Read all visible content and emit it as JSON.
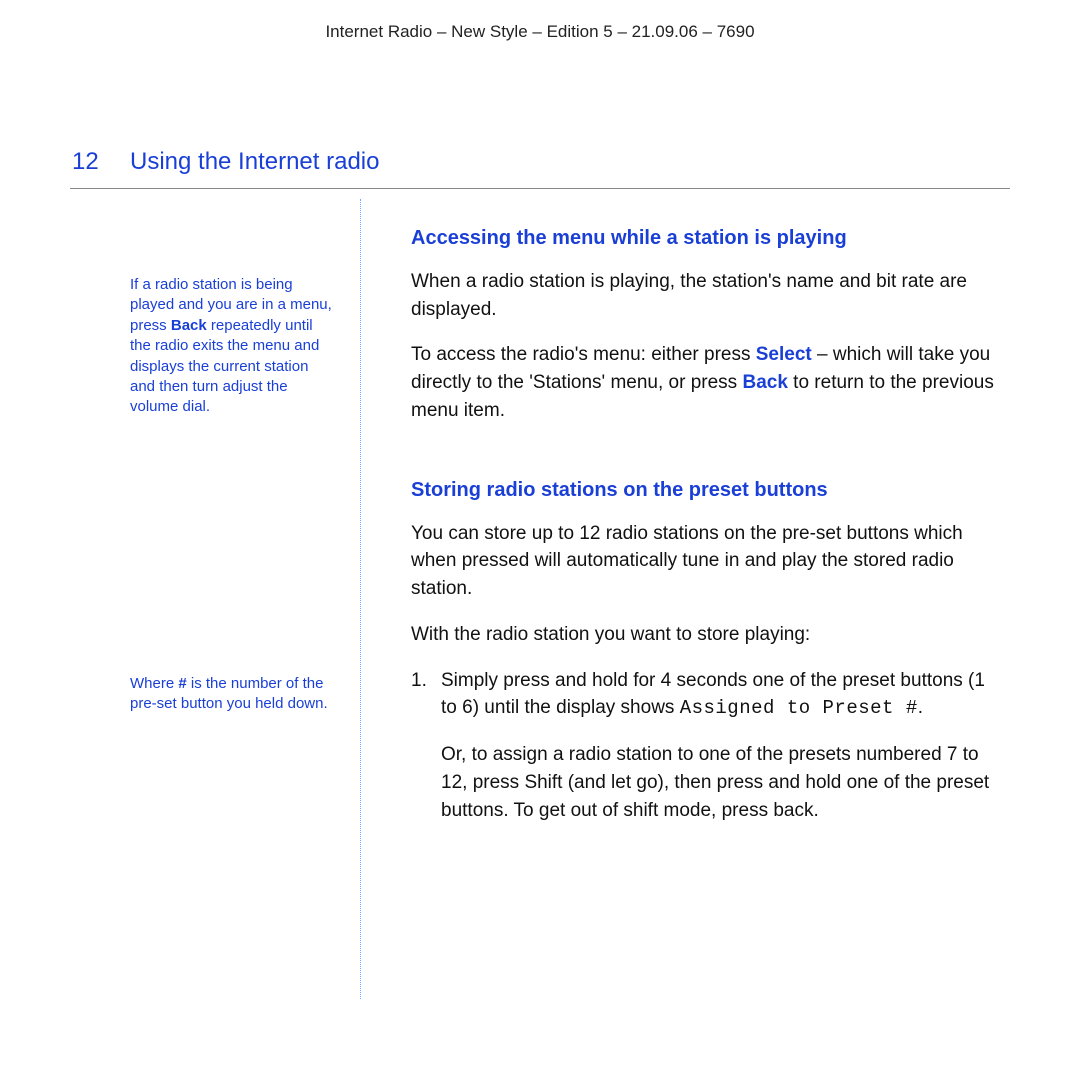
{
  "header": "Internet Radio – New Style – Edition 5 – 21.09.06 – 7690",
  "chapter": {
    "number": "12",
    "title": "Using the Internet radio"
  },
  "sidebar": {
    "note1_pre": "If a radio station is being played and you are in a menu, press ",
    "note1_bold": "Back",
    "note1_post": " repeatedly until the radio exits the menu and displays the current station and then turn adjust the volume dial.",
    "note2_pre": "Where ",
    "note2_bold": "#",
    "note2_post": " is the number of the pre-set button you held down."
  },
  "main": {
    "h1": "Accessing the menu while a station is playing",
    "p1": "When a radio station is playing, the station's name and bit rate are displayed.",
    "p2_a": "To access the radio's menu: either press ",
    "p2_select": "Select",
    "p2_b": " – which will take you directly to the 'Stations' menu, or press ",
    "p2_back": "Back",
    "p2_c": " to return to the previous menu item.",
    "h2": "Storing radio stations on the preset buttons",
    "p3": "You can store up to 12 radio stations on the pre-set buttons which when pressed will automatically tune in and play the stored radio station.",
    "p4": "With the radio station you want to store playing:",
    "li1_num": "1.",
    "li1_a": "Simply press and hold for 4 seconds one of the preset buttons (",
    "li1_one": "1",
    "li1_b": " to ",
    "li1_six": "6",
    "li1_c": ") until the display shows ",
    "li1_lcd": "Assigned to Preset #",
    "li1_d": ".",
    "li1_follow_a": "Or, to assign a radio station to one of the presets numbered 7 to 12, press ",
    "li1_follow_bold": "Shift (and let go)",
    "li1_follow_b": ", then press and hold one of the preset buttons. To get out of shift mode, press back."
  }
}
